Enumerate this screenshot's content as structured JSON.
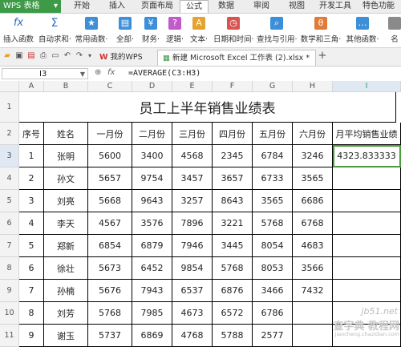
{
  "app": {
    "logo": "WPS 表格",
    "logo_arrow": "▾"
  },
  "menu": [
    "开始",
    "插入",
    "页面布局",
    "公式",
    "数据",
    "审阅",
    "视图",
    "开发工具",
    "特色功能"
  ],
  "ribbon": [
    {
      "label": "插入函数",
      "icon": "fx"
    },
    {
      "label": "自动求和·",
      "icon": "Σ"
    },
    {
      "label": "常用函数·",
      "icon": "★"
    },
    {
      "label": "全部·",
      "icon": "▤"
    },
    {
      "label": "财务·",
      "icon": "¥"
    },
    {
      "label": "逻辑·",
      "icon": "?"
    },
    {
      "label": "文本·",
      "icon": "A"
    },
    {
      "label": "日期和时间·",
      "icon": "◷"
    },
    {
      "label": "查找与引用·",
      "icon": "⌕"
    },
    {
      "label": "数学和三角·",
      "icon": "θ"
    },
    {
      "label": "其他函数·",
      "icon": "…"
    },
    {
      "label": "名",
      "icon": ""
    }
  ],
  "tabs": {
    "home": "我的WPS",
    "doc": "新建 Microsoft Excel 工作表 (2).xlsx *",
    "add": "+"
  },
  "formula_bar": {
    "cell_ref": "I3",
    "formula": "=AVERAGE(C3:H3)"
  },
  "columns": [
    "A",
    "B",
    "C",
    "D",
    "E",
    "F",
    "G",
    "H",
    "I"
  ],
  "row_numbers": [
    "1",
    "2",
    "3",
    "4",
    "5",
    "6",
    "7",
    "8",
    "9",
    "10",
    "11"
  ],
  "title": "员工上半年销售业绩表",
  "headers": [
    "序号",
    "姓名",
    "一月份",
    "二月份",
    "三月份",
    "四月份",
    "五月份",
    "六月份",
    "月平均销售业绩"
  ],
  "rows": [
    [
      "1",
      "张明",
      "5600",
      "3400",
      "4568",
      "2345",
      "6784",
      "3246",
      "4323.833333"
    ],
    [
      "2",
      "孙文",
      "5657",
      "9754",
      "3457",
      "3657",
      "6733",
      "3565",
      ""
    ],
    [
      "3",
      "刘亮",
      "5668",
      "9643",
      "3257",
      "8643",
      "3565",
      "6686",
      ""
    ],
    [
      "4",
      "李天",
      "4567",
      "3576",
      "7896",
      "3221",
      "5768",
      "6768",
      ""
    ],
    [
      "5",
      "郑新",
      "6854",
      "6879",
      "7946",
      "3445",
      "8054",
      "4683",
      ""
    ],
    [
      "6",
      "徐壮",
      "5673",
      "6452",
      "9854",
      "5768",
      "8053",
      "3566",
      ""
    ],
    [
      "7",
      "孙楠",
      "5676",
      "7943",
      "6537",
      "6876",
      "3466",
      "7432",
      ""
    ],
    [
      "8",
      "刘芳",
      "5768",
      "7985",
      "4673",
      "6572",
      "6786",
      ""
    ],
    [
      "9",
      "谢玉",
      "5737",
      "6869",
      "4768",
      "5788",
      "2577",
      ""
    ]
  ],
  "watermark": {
    "site": "jb51.net",
    "brand": "查字典 教程网",
    "url": "jiaocheng.chazidian.com"
  }
}
